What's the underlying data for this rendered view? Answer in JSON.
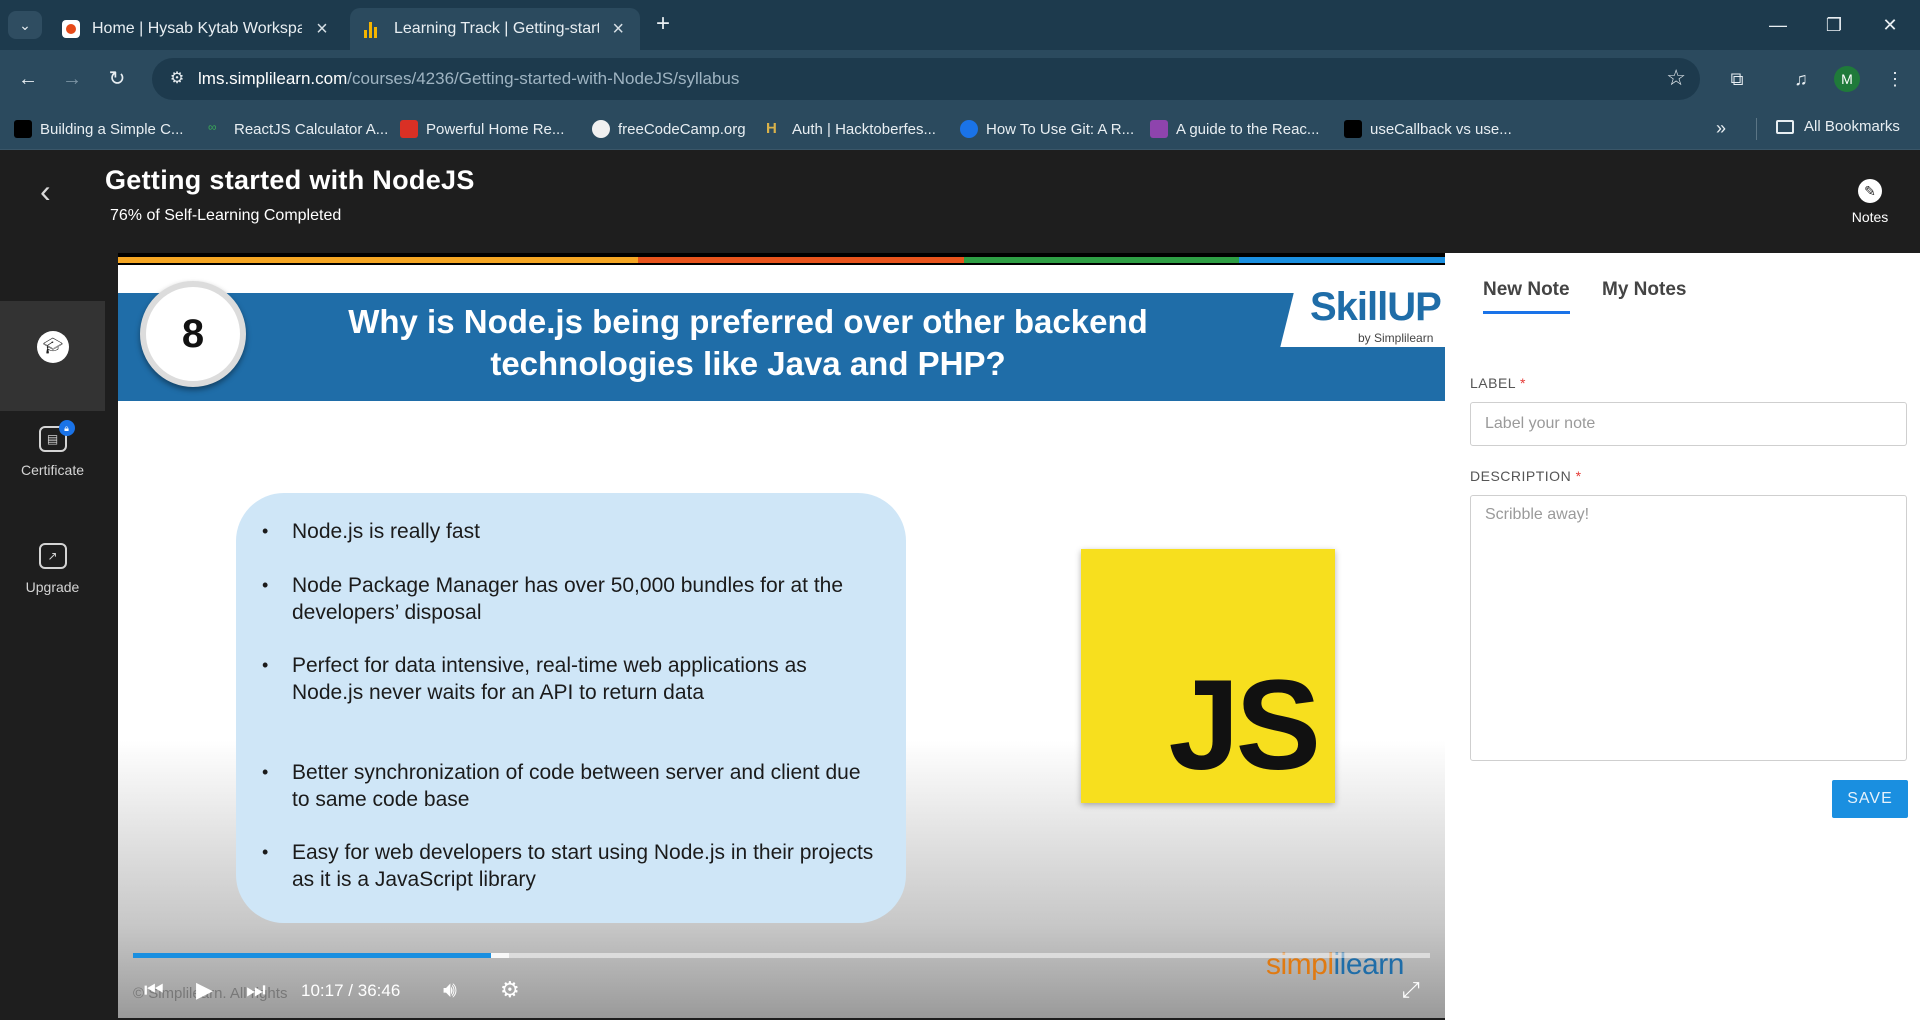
{
  "browser": {
    "tabs": [
      {
        "title": "Home | Hysab Kytab Workspace",
        "active": false
      },
      {
        "title": "Learning Track | Getting-started",
        "active": true
      }
    ],
    "address": {
      "host": "lms.simplilearn.com",
      "path": "/courses/4236/Getting-started-with-NodeJS/syllabus"
    },
    "profile_initial": "M",
    "bookmarks": [
      "Building a Simple C...",
      "ReactJS Calculator A...",
      "Powerful Home Re...",
      "freeCodeCamp.org",
      "Auth | Hacktoberfes...",
      "How To Use Git: A R...",
      "A guide to the Reac...",
      "useCallback vs use..."
    ],
    "all_bookmarks": "All Bookmarks"
  },
  "course": {
    "title": "Getting started with NodeJS",
    "progress_text": "76% of Self-Learning Completed",
    "progress_percent": 76,
    "notes_label": "Notes"
  },
  "sidebar": {
    "items": [
      {
        "label": "Certificate",
        "icon": "certificate-icon",
        "locked": true
      },
      {
        "label": "Upgrade",
        "icon": "upgrade-icon"
      }
    ]
  },
  "video": {
    "slide_number": "8",
    "question": "Why is Node.js being preferred over other backend technologies like Java and PHP?",
    "brand": "SkillUP",
    "brand_sub": "by Simplilearn",
    "bullets": [
      "Node.js is really fast",
      "Node Package Manager has over 50,000 bundles for at the developers’ disposal",
      "Perfect for data intensive, real-time web applications as Node.js never waits for an API to return data",
      "Better synchronization of code between server and client due to same code base",
      "Easy for web developers to start using Node.js in their projects as it is a JavaScript library"
    ],
    "js_logo": "JS",
    "watermark_a": "simpl",
    "watermark_b": "ilearn",
    "copyright_ghost": "© Simplilearn. All rights",
    "current_time": "10:17",
    "separator": "/",
    "duration": "36:46",
    "played_fraction": 0.276,
    "buffered_fraction": 0.29
  },
  "notes": {
    "tabs": [
      "New Note",
      "My Notes"
    ],
    "label_title": "LABEL",
    "label_placeholder": "Label your note",
    "description_title": "DESCRIPTION",
    "description_placeholder": "Scribble away!",
    "required_mark": "*",
    "save_label": "SAVE"
  },
  "colors": {
    "accent": "#1a8fe0",
    "banner": "#1f6da8",
    "chrome": "#1d3a4d",
    "js_yellow": "#f7df1e"
  }
}
